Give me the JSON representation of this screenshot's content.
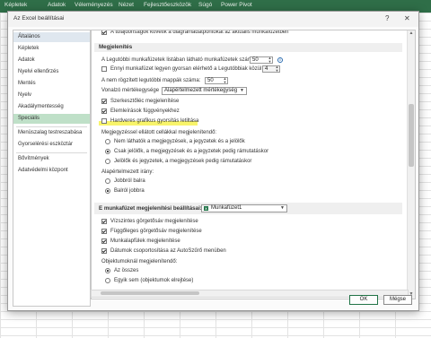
{
  "background": {
    "ribbon_tabs": [
      "Kezdőlap",
      "Beszúrás",
      "Lap elrendezése",
      "Képletek",
      "Adatok",
      "Véleményezés",
      "Nézet",
      "Fejlesztőeszközök",
      "Súgó",
      "Power Pivot"
    ]
  },
  "dialog": {
    "title": "Az Excel beállításai",
    "help_label": "?",
    "close_label": "✕"
  },
  "nav": {
    "items": [
      "Általános",
      "Képletek",
      "Adatok",
      "Nyelvi ellenőrzés",
      "Mentés",
      "Nyelv",
      "Akadálymentesség",
      "Speciális",
      "Menüszalag testreszabása",
      "Gyorselérési eszköztár",
      "Bővítmények",
      "Adatvédelmi központ"
    ],
    "active_index": 7
  },
  "panel": {
    "top_cut_text": "A tulajdonságok követik a diagramadatpontokat az aktuális munkafüzetben",
    "display_section": "Megjelenítés",
    "recent_workbooks_label": "A Legutóbbi munkafüzetek listában látható munkafüzetek száma:",
    "recent_workbooks_value": "50",
    "quick_access_label": "Ennyi munkafüzet legyen gyorsan elérhető a Legutóbbiak közül:",
    "quick_access_value": "4",
    "unpinned_folders_label": "A nem rögzített legutóbbi mappák száma:",
    "unpinned_folders_value": "50",
    "ruler_units_label": "Vonalzó mértékegysége",
    "ruler_units_value": "Alapértelmezett mértékegység",
    "show_formula_bar": "Szerkesztőléc megjelenítése",
    "function_screentips": "Elemleírások függvényekhez",
    "disable_hw_accel": "Hardveres grafikus gyorsítás letiltása",
    "comments_label": "Megjegyzéssel ellátott cellákkal megjelenítendő:",
    "comments_opt1": "Nem láthatók a megjegyzések, a jegyzetek és a jelölők",
    "comments_opt2": "Csak jelölők, a megjegyzések és a jegyzetek pedig rámutatáskor",
    "comments_opt3": "Jelölők és jegyzetek, a megjegyzések pedig rámutatáskor",
    "direction_label": "Alapértelmezett irány:",
    "direction_opt1": "Jobbról balra",
    "direction_opt2": "Balról jobbra",
    "workbook_section": "E munkafüzet megjelenítési beállításai:",
    "workbook_value": "Munkafüzet1",
    "workbook_icon": "X",
    "show_hscroll": "Vízszintes görgetősáv megjelenítése",
    "show_vscroll": "Függőleges görgetősáv megjelenítése",
    "show_sheet_tabs": "Munkalapfülek megjelenítése",
    "group_dates": "Dátumok csoportosítása az AutoSzűrő menüben",
    "objects_label": "Objektumoknál megjelenítendő:",
    "objects_opt1": "Az összes",
    "objects_opt2": "Egyik sem (objektumok elrejtése)"
  },
  "buttons": {
    "ok": "OK",
    "cancel": "Mégse"
  },
  "colors": {
    "highlight": "#f5f03a",
    "active_nav": "#bfe0c8",
    "excel_green": "#217346"
  }
}
